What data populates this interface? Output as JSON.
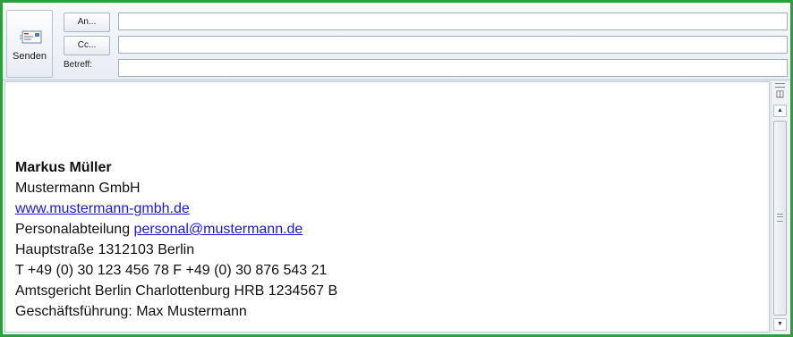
{
  "header": {
    "send_label": "Senden",
    "to_label": "An...",
    "cc_label": "Cc...",
    "subject_label": "Betreff:",
    "to_value": "",
    "cc_value": "",
    "subject_value": ""
  },
  "signature": {
    "name": "Markus Müller",
    "company": "Mustermann GmbH",
    "website": "www.mustermann-gmbh.de",
    "department_prefix": "Personalabteilung ",
    "department_email": "personal@mustermann.de",
    "address": "Hauptstraße 1312103 Berlin",
    "phone": "T +49 (0) 30 123 456 78 F +49 (0) 30 876 543 21",
    "register": "Amtsgericht Berlin Charlottenburg HRB 1234567 B",
    "management": "Geschäftsführung: Max Mustermann"
  },
  "colors": {
    "frame_border": "#2e9e3a",
    "link": "#1a1ad6"
  }
}
